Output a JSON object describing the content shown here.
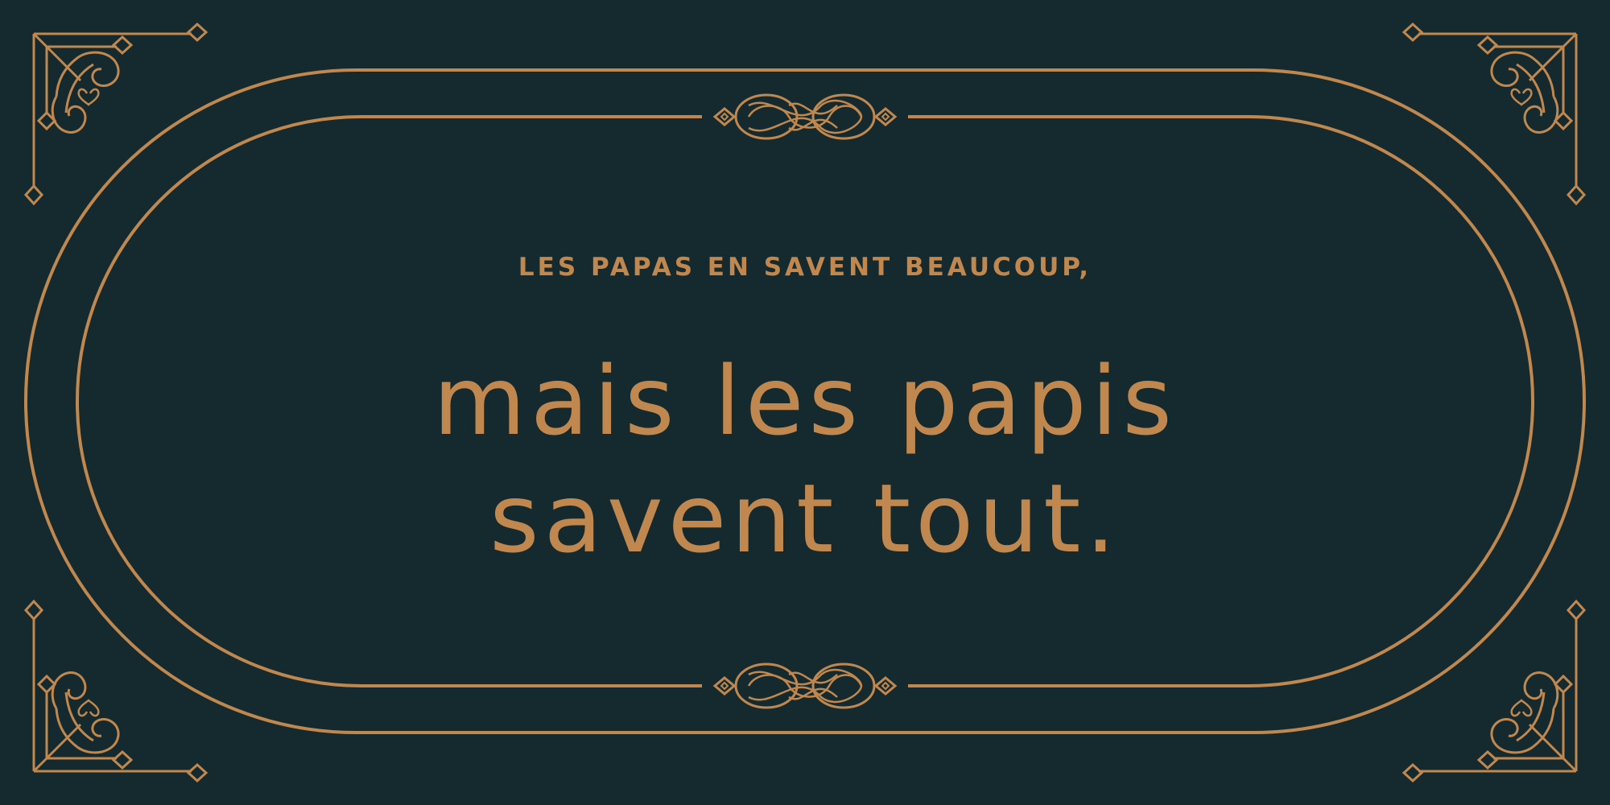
{
  "colors": {
    "background": "#152a2e",
    "accent": "#c0884f"
  },
  "tagline": "LES PAPAS EN SAVENT BEAUCOUP,",
  "headline": {
    "line1": "mais les papis",
    "line2": "savent tout."
  },
  "ornaments": {
    "frame": "double-rounded-frame",
    "flourishes": [
      "top-flourish-icon",
      "bottom-flourish-icon"
    ],
    "corners": [
      "top-left-corner-ornament",
      "top-right-corner-ornament",
      "bottom-left-corner-ornament",
      "bottom-right-corner-ornament"
    ]
  }
}
